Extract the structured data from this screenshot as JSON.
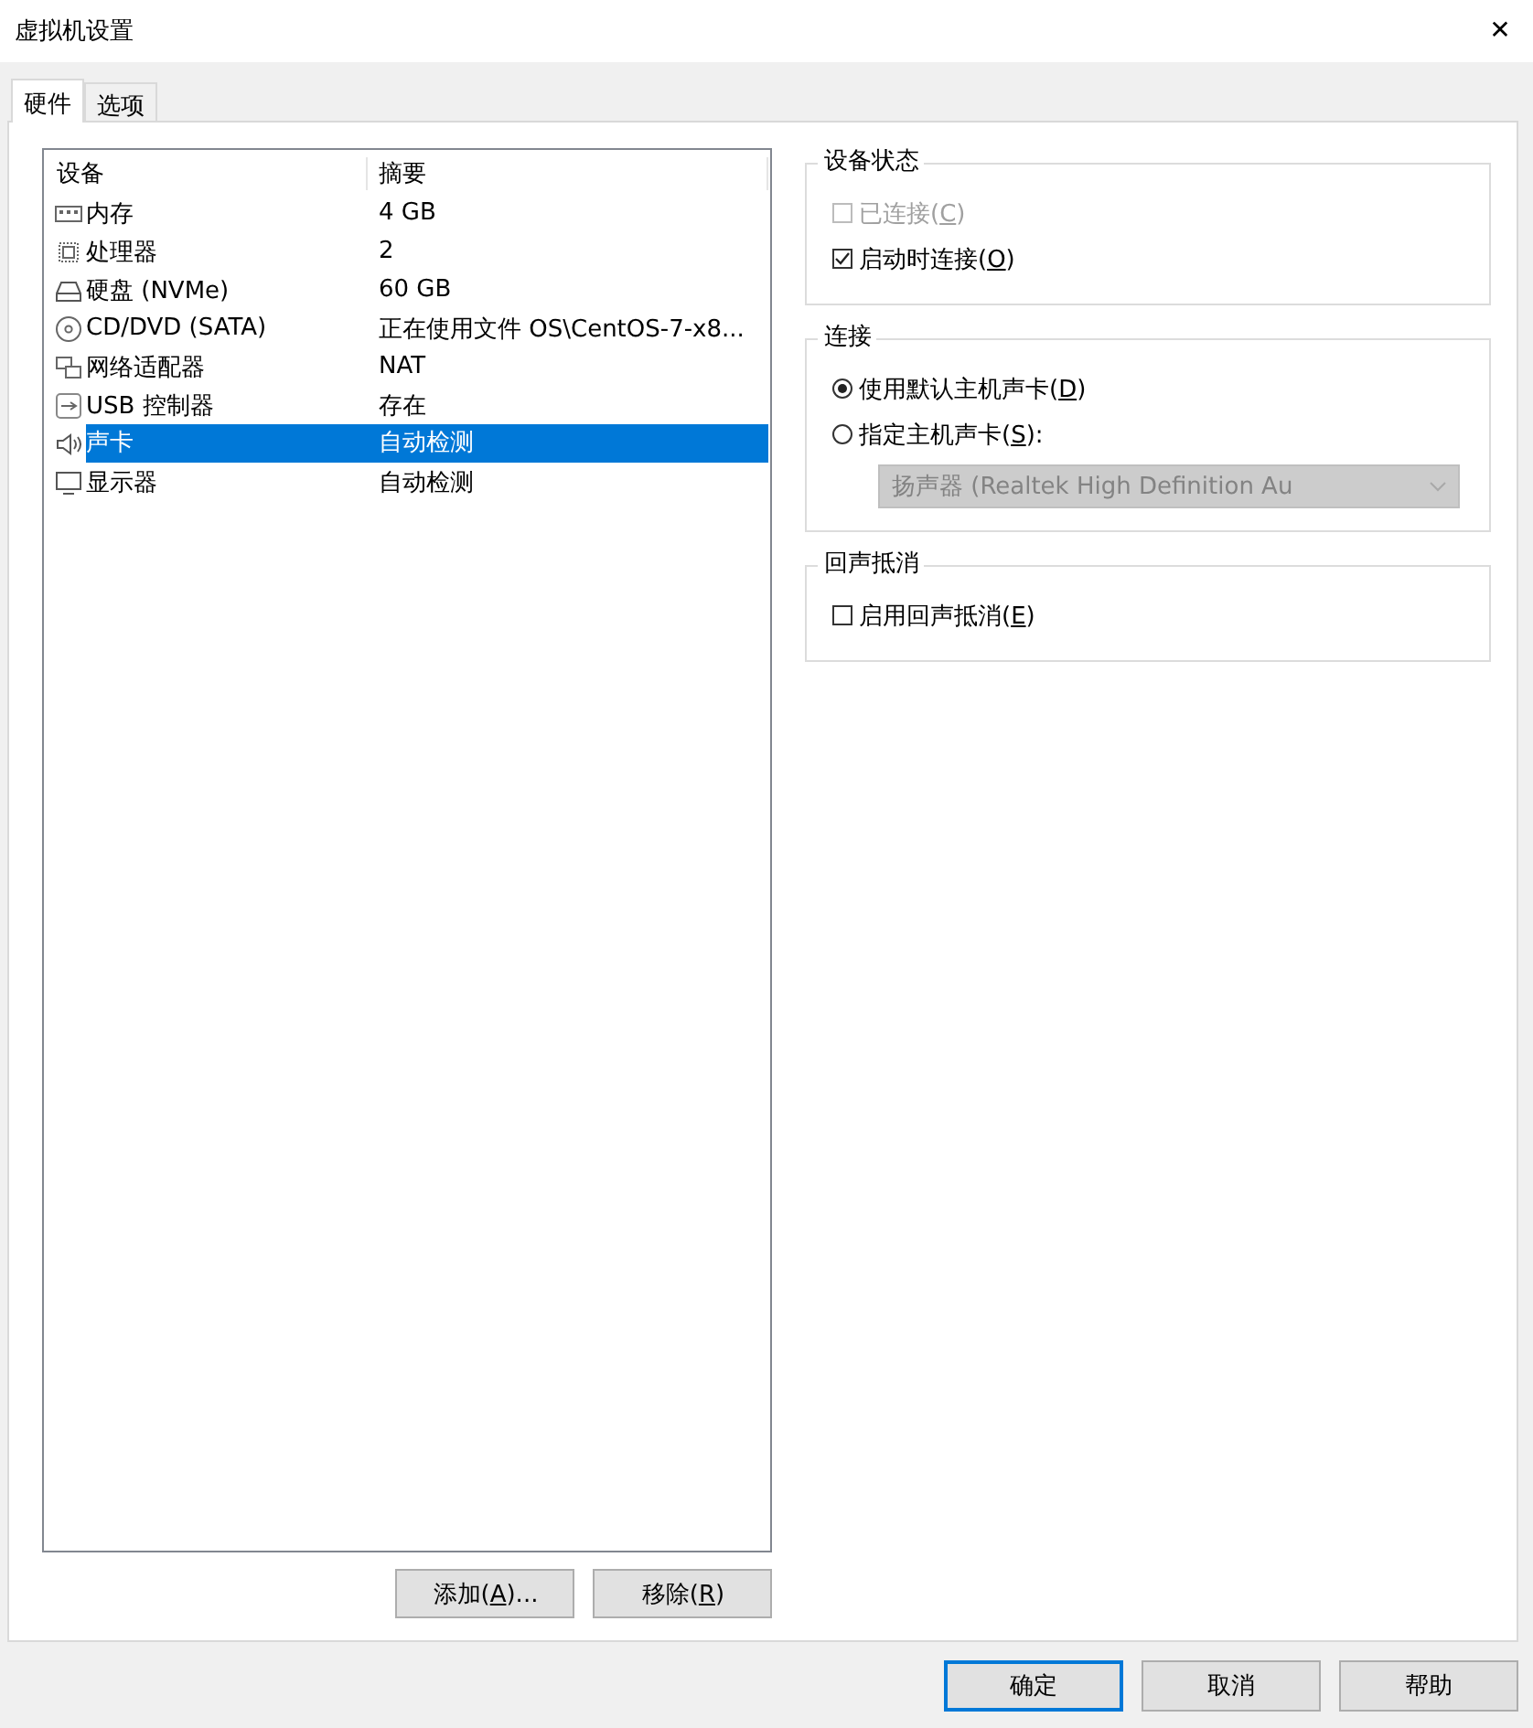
{
  "window": {
    "title": "虚拟机设置",
    "close": "✕"
  },
  "tabs": [
    {
      "label": "硬件",
      "selected": true
    },
    {
      "label": "选项",
      "selected": false
    }
  ],
  "device_list": {
    "columns": [
      "设备",
      "摘要"
    ],
    "rows": [
      {
        "kind": "memory",
        "device": "内存",
        "summary": "4 GB",
        "selected": false
      },
      {
        "kind": "cpu",
        "device": "处理器",
        "summary": "2",
        "selected": false
      },
      {
        "kind": "disk",
        "device": "硬盘 (NVMe)",
        "summary": "60 GB",
        "selected": false
      },
      {
        "kind": "cd",
        "device": "CD/DVD (SATA)",
        "summary": "正在使用文件 OS\\CentOS-7-x8...",
        "selected": false
      },
      {
        "kind": "network",
        "device": "网络适配器",
        "summary": "NAT",
        "selected": false
      },
      {
        "kind": "usb",
        "device": "USB 控制器",
        "summary": "存在",
        "selected": false
      },
      {
        "kind": "sound",
        "device": "声卡",
        "summary": "自动检测",
        "selected": true
      },
      {
        "kind": "display",
        "device": "显示器",
        "summary": "自动检测",
        "selected": false
      }
    ]
  },
  "list_buttons": [
    "添加(A)...",
    "移除(R)"
  ],
  "groups": [
    {
      "title": "设备状态",
      "items": [
        {
          "kind": "checkbox",
          "label": "已连接(C)",
          "checked": false,
          "disabled": true
        },
        {
          "kind": "checkbox",
          "label": "启动时连接(O)",
          "checked": true,
          "disabled": false
        }
      ]
    },
    {
      "title": "连接",
      "items": [
        {
          "kind": "radio",
          "label": "使用默认主机声卡(D)",
          "selected": true
        },
        {
          "kind": "radio",
          "label": "指定主机声卡(S):",
          "selected": false
        },
        {
          "kind": "dropdown",
          "value": "扬声器 (Realtek High Definition Au",
          "disabled": true
        }
      ]
    },
    {
      "title": "回声抵消",
      "items": [
        {
          "kind": "checkbox",
          "label": "启用回声抵消(E)",
          "checked": false,
          "disabled": false
        }
      ]
    }
  ],
  "dialog_buttons": [
    {
      "label": "确定",
      "default": true
    },
    {
      "label": "取消",
      "default": false
    },
    {
      "label": "帮助",
      "default": false
    }
  ]
}
